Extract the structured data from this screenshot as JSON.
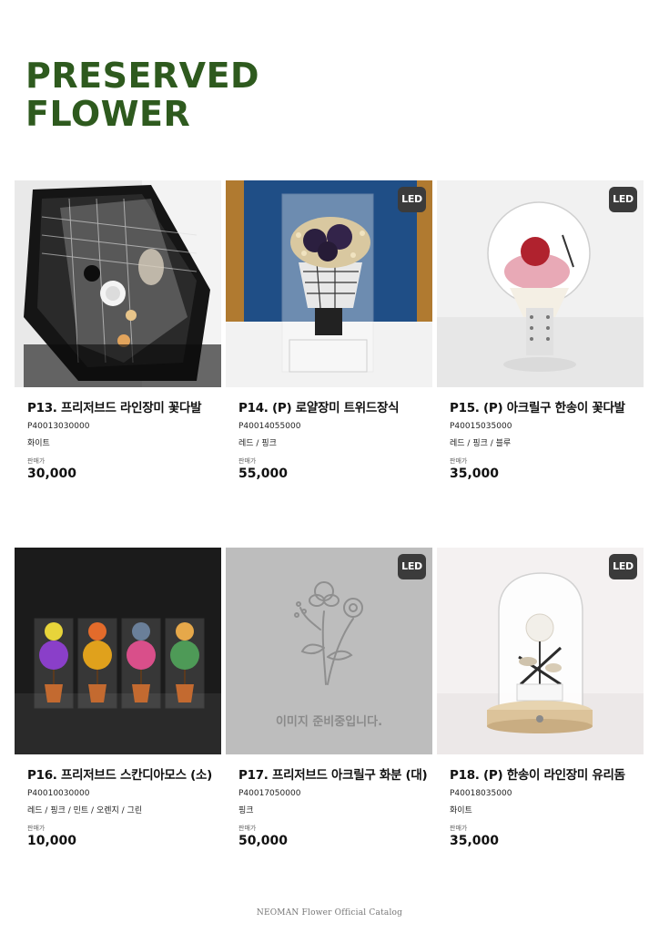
{
  "page": {
    "title_line1": "PRESERVED",
    "title_line2": "FLOWER",
    "footer": "NEOMAN Flower Official Catalog"
  },
  "labels": {
    "price_label": "판매가",
    "led_badge": "LED",
    "placeholder_text": "이미지 준비중입니다."
  },
  "colors": {
    "title": "#2e5a1e",
    "led_badge_bg": "#3b3b3b"
  },
  "products": [
    {
      "name": "P13. 프리저브드 라인장미 꽃다발",
      "code": "P40013030000",
      "colors": "화이트",
      "price": "30,000",
      "led": false,
      "image": "bouquet-photo"
    },
    {
      "name": "P14. (P) 로얄장미 트위드장식",
      "code": "P40014055000",
      "colors": "레드 / 핑크",
      "price": "55,000",
      "led": true,
      "image": "tweed-rose-box-photo"
    },
    {
      "name": "P15. (P) 아크릴구 한송이 꽃다발",
      "code": "P40015035000",
      "colors": "레드 / 핑크 / 블루",
      "price": "35,000",
      "led": true,
      "image": "acrylic-sphere-photo"
    },
    {
      "name": "P16. 프리저브드 스칸디아모스 (소)",
      "code": "P40010030000",
      "colors": "레드 / 핑크 / 민트 / 오렌지 / 그린",
      "price": "10,000",
      "led": false,
      "image": "moss-pots-photo"
    },
    {
      "name": "P17. 프리저브드 아크릴구 화분 (대)",
      "code": "P40017050000",
      "colors": "핑크",
      "price": "50,000",
      "led": true,
      "image": "placeholder"
    },
    {
      "name": "P18. (P) 한송이 라인장미 유리돔",
      "code": "P40018035000",
      "colors": "화이트",
      "price": "35,000",
      "led": true,
      "image": "glass-dome-photo"
    }
  ]
}
